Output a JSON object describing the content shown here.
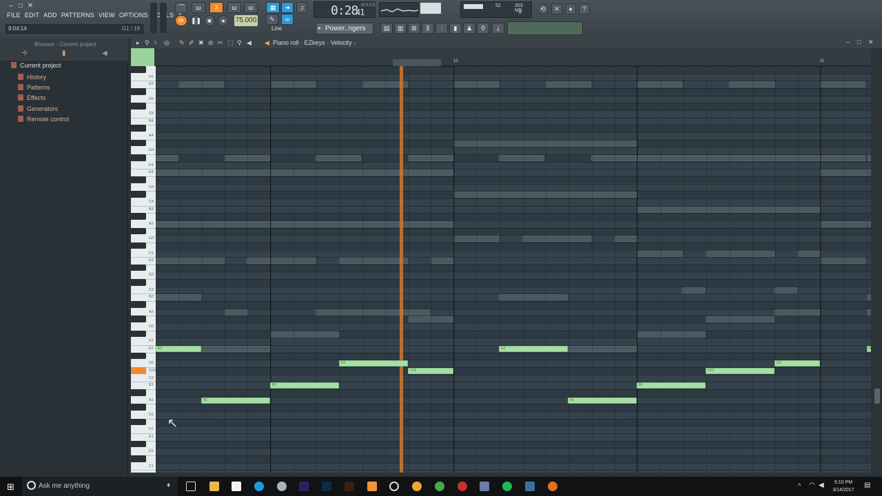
{
  "app": {
    "menu": [
      "FILE",
      "EDIT",
      "ADD",
      "PATTERNS",
      "VIEW",
      "OPTIONS",
      "TOOLS",
      "?"
    ],
    "hint_left": "9:04:14",
    "hint_right": "G1 / 19",
    "time_display": "0:28",
    "time_small": "41",
    "time_unit": "M:S:CS",
    "tempo": "75.000",
    "cpu_value": "52",
    "memory": "353 MB",
    "polyphony": "6",
    "preset_label": "Power..ngers",
    "snap_label": "Line"
  },
  "browser": {
    "title": "Browser - Current project",
    "root": "Current project",
    "items": [
      "History",
      "Patterns",
      "Effects",
      "Generators",
      "Remote control"
    ]
  },
  "piano_roll": {
    "crumb_1": "Piano roll",
    "crumb_2": "EZkeys",
    "crumb_3": "Velocity",
    "bar_10": "10",
    "bar_11": "11",
    "key_labels": [
      "F5",
      "E5",
      "D5",
      "C5",
      "B4",
      "A4",
      "G4",
      "F4",
      "E4",
      "D4",
      "C4",
      "B3",
      "A3",
      "G3",
      "F3",
      "E3",
      "D3",
      "C3",
      "B2",
      "A2",
      "G2",
      "F2",
      "E2",
      "D2",
      "C#2",
      "C2",
      "B1",
      "A1",
      "G1",
      "F1",
      "E1",
      "D1",
      "C1"
    ],
    "notes": [
      {
        "label": "E2"
      },
      {
        "label": "A1"
      },
      {
        "label": "B1"
      },
      {
        "label": "D2"
      },
      {
        "label": "C#2"
      },
      {
        "label": "E2"
      },
      {
        "label": "A1"
      },
      {
        "label": "B1"
      },
      {
        "label": "C#2"
      },
      {
        "label": "D2"
      },
      {
        "label": "E2"
      }
    ]
  },
  "taskbar": {
    "search_placeholder": "Ask me anything",
    "time": "5:10 PM",
    "date": "3/14/2017"
  },
  "colors": {
    "note": "#a9dda7",
    "playhead": "#d1792a",
    "accent_blue": "#2f9ad8",
    "accent_orange": "#f08a30"
  }
}
